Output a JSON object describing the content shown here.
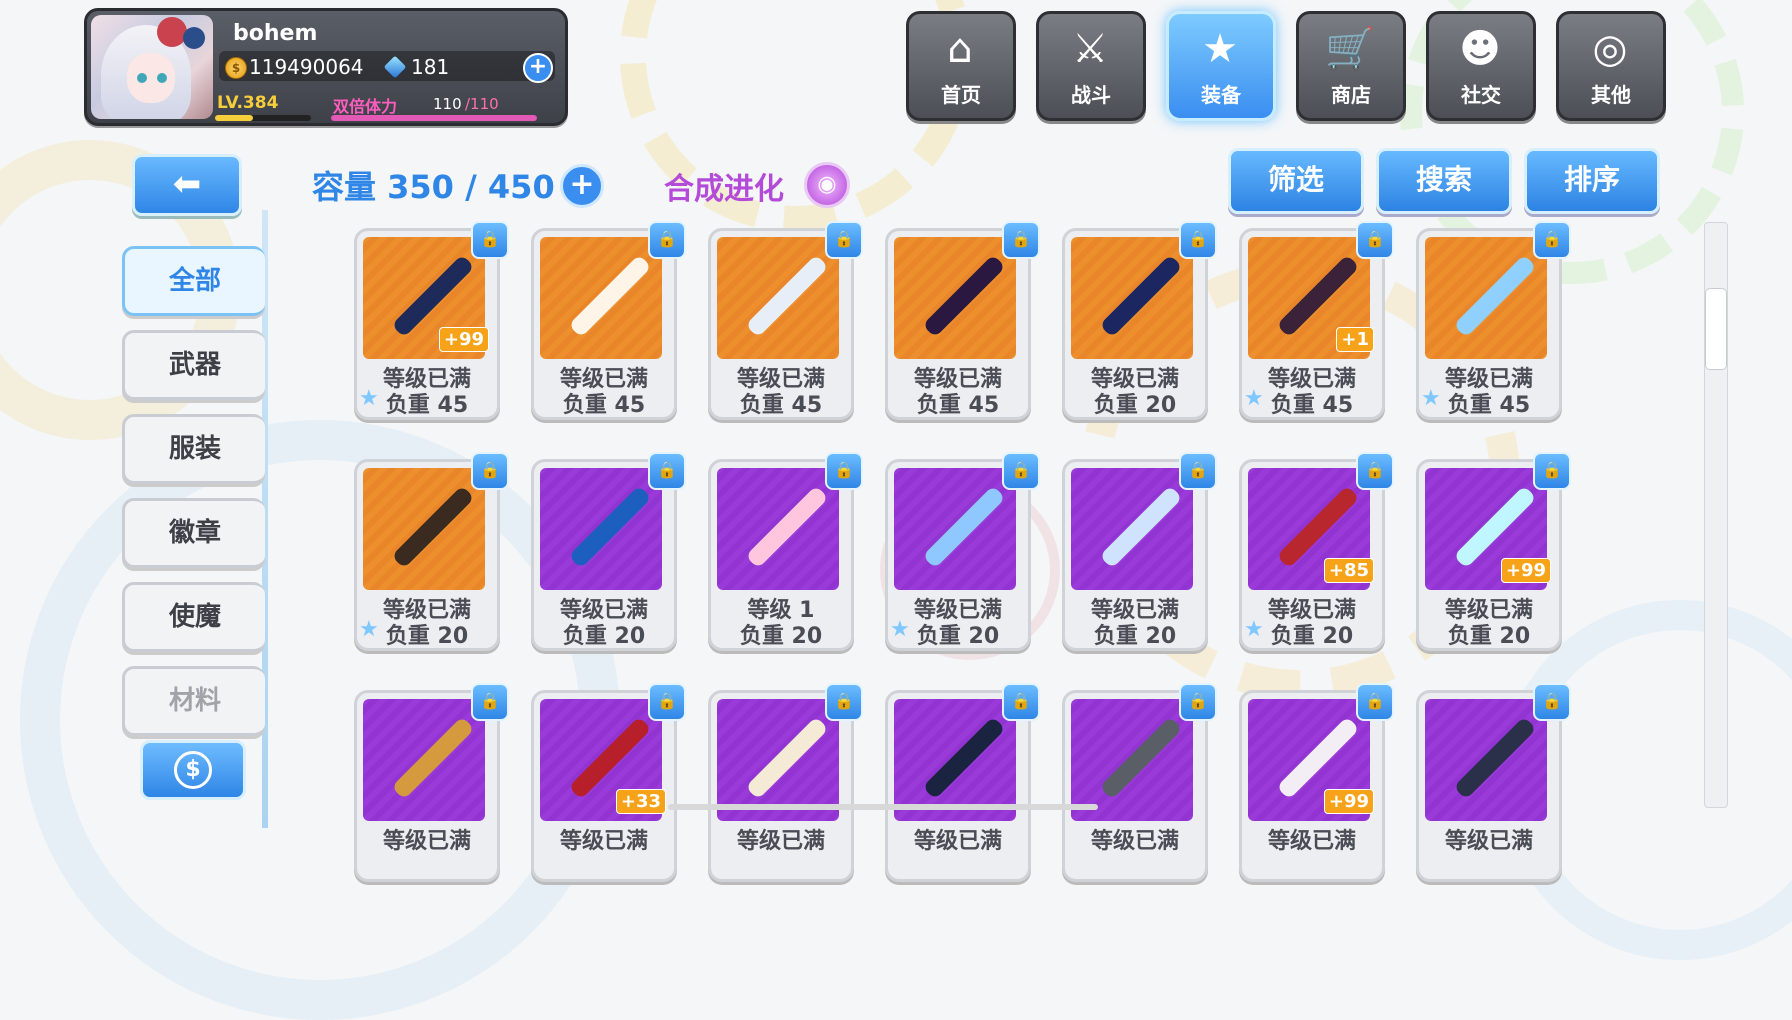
{
  "player": {
    "name": "bohem",
    "gold": "119490064",
    "gems": "181",
    "level": "LV.384",
    "stamina_label": "双倍体力",
    "stamina_current": "110",
    "stamina_max": "/110",
    "exp_fill": 0.4,
    "stamina_fill": 1.0
  },
  "nav": {
    "items": [
      {
        "label": "首页",
        "icon": "house-icon"
      },
      {
        "label": "战斗",
        "icon": "swords-icon"
      },
      {
        "label": "装备",
        "icon": "star-gun-icon"
      },
      {
        "label": "商店",
        "icon": "cart-icon"
      },
      {
        "label": "社交",
        "icon": "friend-icon"
      },
      {
        "label": "其他",
        "icon": "spiral-icon"
      }
    ],
    "active": "装备"
  },
  "sidebar": {
    "tabs": [
      "全部",
      "武器",
      "服装",
      "徽章",
      "使魔",
      "材料"
    ],
    "active": "全部"
  },
  "toolbar": {
    "capacity": "容量 350 / 450",
    "synth": "合成进化",
    "filter": "筛选",
    "search": "搜索",
    "sort": "排序"
  },
  "items": [
    {
      "bg": "orange",
      "status": "等级已满",
      "weight": "负重 45",
      "plus": "+99",
      "star": true
    },
    {
      "bg": "orange",
      "status": "等级已满",
      "weight": "负重 45",
      "plus": "",
      "star": false
    },
    {
      "bg": "orange",
      "status": "等级已满",
      "weight": "负重 45",
      "plus": "",
      "star": false
    },
    {
      "bg": "orange",
      "status": "等级已满",
      "weight": "负重 45",
      "plus": "",
      "star": false
    },
    {
      "bg": "orange",
      "status": "等级已满",
      "weight": "负重 20",
      "plus": "",
      "star": false
    },
    {
      "bg": "orange",
      "status": "等级已满",
      "weight": "负重 45",
      "plus": "+1",
      "star": true
    },
    {
      "bg": "orange",
      "status": "等级已满",
      "weight": "负重 45",
      "plus": "",
      "star": true
    },
    {
      "bg": "orange",
      "status": "等级已满",
      "weight": "负重 20",
      "plus": "",
      "star": true
    },
    {
      "bg": "purple",
      "status": "等级已满",
      "weight": "负重 20",
      "plus": "",
      "star": false
    },
    {
      "bg": "purple",
      "status": "等级 1",
      "weight": "负重 20",
      "plus": "",
      "star": false
    },
    {
      "bg": "purple",
      "status": "等级已满",
      "weight": "负重 20",
      "plus": "",
      "star": true
    },
    {
      "bg": "purple",
      "status": "等级已满",
      "weight": "负重 20",
      "plus": "",
      "star": false
    },
    {
      "bg": "purple",
      "status": "等级已满",
      "weight": "负重 20",
      "plus": "+85",
      "star": true
    },
    {
      "bg": "purple",
      "status": "等级已满",
      "weight": "负重 20",
      "plus": "+99",
      "star": false
    },
    {
      "bg": "purple",
      "status": "等级已满",
      "weight": "",
      "plus": "",
      "star": false
    },
    {
      "bg": "purple",
      "status": "等级已满",
      "weight": "",
      "plus": "+33",
      "star": false
    },
    {
      "bg": "purple",
      "status": "等级已满",
      "weight": "",
      "plus": "",
      "star": false
    },
    {
      "bg": "purple",
      "status": "等级已满",
      "weight": "",
      "plus": "",
      "star": false
    },
    {
      "bg": "purple",
      "status": "等级已满",
      "weight": "",
      "plus": "",
      "star": false
    },
    {
      "bg": "purple",
      "status": "等级已满",
      "weight": "",
      "plus": "+99",
      "star": false
    },
    {
      "bg": "purple",
      "status": "等级已满",
      "weight": "",
      "plus": "",
      "star": false
    }
  ],
  "colors": {
    "accent": "#2f86e6",
    "orange_slot": "#ec8f2c",
    "purple_slot": "#9a3ad8",
    "synth": "#b34bd8"
  }
}
